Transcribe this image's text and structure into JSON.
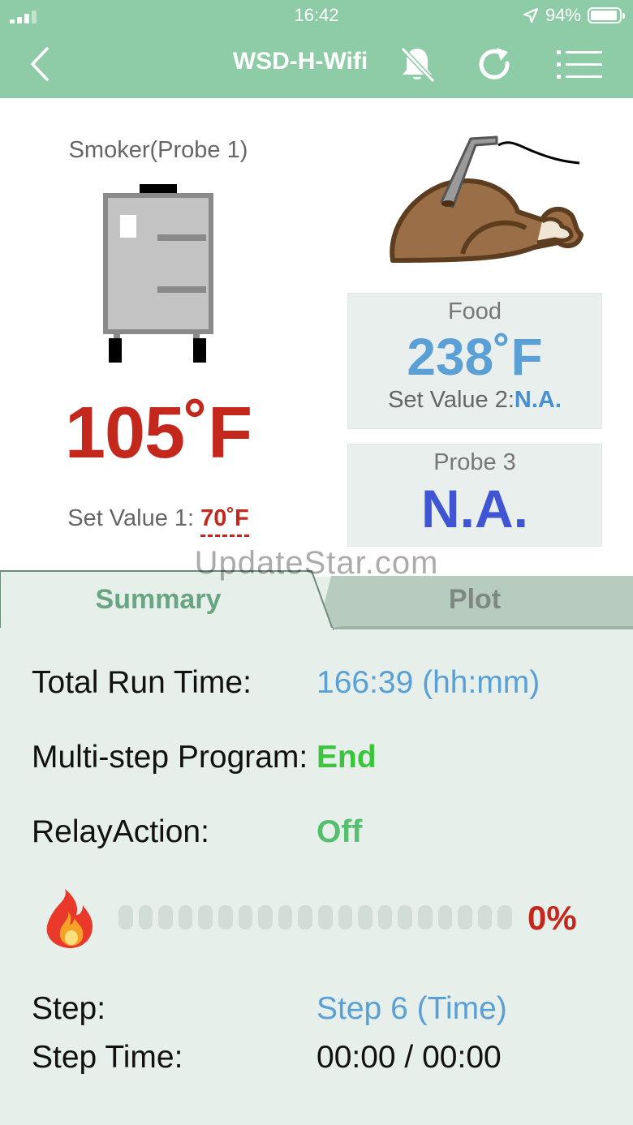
{
  "status_bar": {
    "time": "16:42",
    "battery": "94%",
    "battery_level": 0.94
  },
  "header": {
    "title": "WSD-H-Wifi",
    "icons": [
      "back-chevron-icon",
      "bell-off-icon",
      "refresh-icon",
      "menu-list-icon"
    ]
  },
  "smoker": {
    "label": "Smoker(Probe 1)",
    "temp": "105˚F",
    "set_label": "Set Value 1: ",
    "set_value": "70˚F"
  },
  "food": {
    "label": "Food",
    "temp": "238˚F",
    "set_label": "Set Value 2:",
    "set_value": "N.A."
  },
  "probe3": {
    "label": "Probe 3",
    "value": "N.A."
  },
  "watermark": "UpdateStar.com",
  "tabs": [
    {
      "label": "Summary",
      "active": true
    },
    {
      "label": "Plot",
      "active": false
    }
  ],
  "summary": {
    "total_run_time_label": "Total Run Time:",
    "total_run_time_value": "166:39 (hh:mm)",
    "program_label": "Multi-step Program:",
    "program_value": "End",
    "relay_label": "RelayAction:",
    "relay_value": "Off",
    "heat_percent": "0%",
    "heat_level": 0,
    "step_label": "Step:",
    "step_value": "Step 6 (Time)",
    "step_time_label": "Step Time:",
    "step_time_value": "00:00 / 00:00"
  },
  "colors": {
    "header_bg": "#8ecba7",
    "panel_bg": "#e6efe9",
    "smoker_temp": "#c4281c",
    "food_temp": "#5a9fd6",
    "probe3_value": "#3f55d4",
    "program_end": "#3cc43c",
    "relay_off": "#54bf6e"
  }
}
